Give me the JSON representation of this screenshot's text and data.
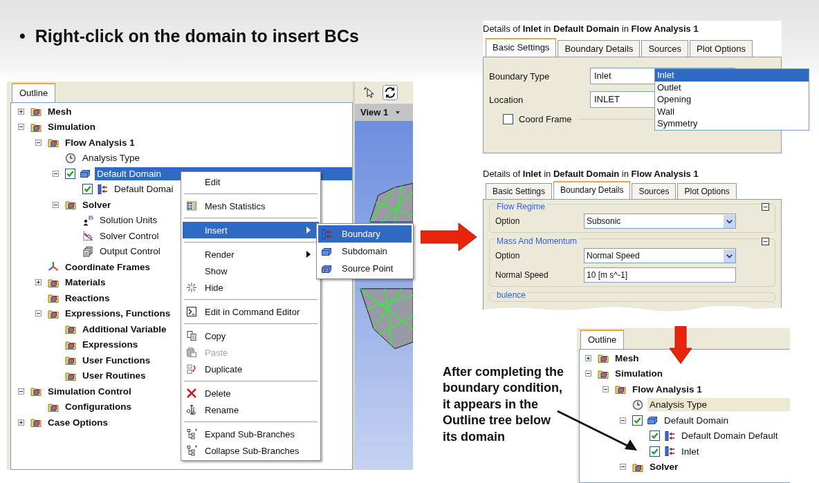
{
  "slide": {
    "bullet": "•",
    "title": "Right-click on the domain to insert BCs"
  },
  "outline": {
    "tab": "Outline",
    "focused": true,
    "tree": [
      {
        "label": "Mesh",
        "kind": "folder",
        "bold": true,
        "expanded": false,
        "selected": false
      },
      {
        "label": "Simulation",
        "kind": "folder",
        "bold": true,
        "expanded": true,
        "selected": false,
        "children": [
          {
            "label": "Flow Analysis 1",
            "kind": "folder",
            "bold": true,
            "expanded": true,
            "selected": false,
            "children": [
              {
                "label": "Analysis Type",
                "kind": "clock",
                "bold": false,
                "selected": false
              },
              {
                "label": "Default Domain",
                "kind": "box",
                "bold": false,
                "expanded": true,
                "checked": true,
                "selected": true,
                "children": [
                  {
                    "label": "Default Domai",
                    "kind": "boundary",
                    "bold": false,
                    "checked": true,
                    "selected": false
                  }
                ]
              },
              {
                "label": "Solver",
                "kind": "folder",
                "bold": true,
                "expanded": true,
                "selected": false,
                "children": [
                  {
                    "label": "Solution Units",
                    "kind": "person",
                    "bold": false,
                    "selected": false
                  },
                  {
                    "label": "Solver Control",
                    "kind": "chart",
                    "bold": false,
                    "selected": false
                  },
                  {
                    "label": "Output Control",
                    "kind": "pages",
                    "bold": false,
                    "selected": false
                  }
                ]
              }
            ]
          },
          {
            "label": "Coordinate Frames",
            "kind": "axes",
            "bold": true,
            "selected": false
          },
          {
            "label": "Materials",
            "kind": "folder",
            "bold": true,
            "expanded": false,
            "selected": false
          },
          {
            "label": "Reactions",
            "kind": "folder",
            "bold": true,
            "selected": false
          },
          {
            "label": "Expressions, Functions",
            "kind": "folder",
            "bold": true,
            "expanded": true,
            "selected": false,
            "children": [
              {
                "label": "Additional Variable",
                "kind": "folder",
                "bold": true,
                "selected": false
              },
              {
                "label": "Expressions",
                "kind": "folder",
                "bold": true,
                "selected": false
              },
              {
                "label": "User Functions",
                "kind": "folder",
                "bold": true,
                "selected": false
              },
              {
                "label": "User Routines",
                "kind": "folder",
                "bold": true,
                "selected": false
              }
            ]
          }
        ]
      },
      {
        "label": "Simulation Control",
        "kind": "folder",
        "bold": true,
        "expanded": true,
        "selected": false,
        "children": [
          {
            "label": "Configurations",
            "kind": "folder",
            "bold": true,
            "selected": false
          }
        ]
      },
      {
        "label": "Case Options",
        "kind": "folder",
        "bold": true,
        "expanded": false,
        "selected": false
      }
    ]
  },
  "viewport": {
    "tab": "View 1"
  },
  "context_menu": {
    "groups": [
      [
        {
          "label": "Edit",
          "selected": false,
          "disabled": false,
          "submenu": false
        }
      ],
      [
        {
          "label": "Mesh Statistics",
          "kind": "grid",
          "selected": false,
          "disabled": false,
          "submenu": false
        }
      ],
      [
        {
          "label": "Insert",
          "selected": true,
          "disabled": false,
          "submenu": true
        }
      ],
      [
        {
          "label": "Render",
          "selected": false,
          "disabled": false,
          "submenu": true
        },
        {
          "label": "Show",
          "selected": false,
          "disabled": false,
          "submenu": false
        },
        {
          "label": "Hide",
          "kind": "sparkle",
          "selected": false,
          "disabled": false,
          "submenu": false
        }
      ],
      [
        {
          "label": "Edit in Command Editor",
          "kind": "terminal",
          "selected": false,
          "disabled": false,
          "submenu": false
        }
      ],
      [
        {
          "label": "Copy",
          "kind": "copy",
          "selected": false,
          "disabled": false,
          "submenu": false
        },
        {
          "label": "Paste",
          "kind": "clipboard",
          "selected": false,
          "disabled": true,
          "submenu": false
        },
        {
          "label": "Duplicate",
          "kind": "duplicate",
          "selected": false,
          "disabled": false,
          "submenu": false
        }
      ],
      [
        {
          "label": "Delete",
          "kind": "delete",
          "selected": false,
          "disabled": false,
          "submenu": false
        },
        {
          "label": "Rename",
          "kind": "rename",
          "selected": false,
          "disabled": false,
          "submenu": false
        }
      ],
      [
        {
          "label": "Expand Sub-Branches",
          "kind": "tree",
          "selected": false,
          "disabled": false,
          "submenu": false
        },
        {
          "label": "Collapse Sub-Branches",
          "kind": "tree",
          "selected": false,
          "disabled": false,
          "submenu": false
        }
      ]
    ]
  },
  "submenu": {
    "items": [
      {
        "label": "Boundary",
        "kind": "boundary",
        "selected": true
      },
      {
        "label": "Subdomain",
        "kind": "box",
        "selected": false
      },
      {
        "label": "Source Point",
        "kind": "boxdot",
        "selected": false
      }
    ]
  },
  "basic_settings_panel": {
    "heading": "Details of **Inlet** in **Default Domain** in **Flow Analysis 1**",
    "tabs": [
      {
        "label": "Basic Settings",
        "selected": true
      },
      {
        "label": "Boundary Details",
        "selected": false
      },
      {
        "label": "Sources",
        "selected": false
      },
      {
        "label": "Plot Options",
        "selected": false
      }
    ],
    "fields": [
      {
        "label": "Boundary Type",
        "value": "Inlet"
      },
      {
        "label": "Location",
        "value": "INLET"
      }
    ],
    "coord_frame": {
      "label": "Coord Frame",
      "checked": false
    },
    "dropdown": {
      "options": [
        {
          "label": "Inlet",
          "selected": true
        },
        {
          "label": "Outlet",
          "selected": false
        },
        {
          "label": "Opening",
          "selected": false
        },
        {
          "label": "Wall",
          "selected": false
        },
        {
          "label": "Symmetry",
          "selected": false
        }
      ]
    }
  },
  "boundary_details_panel": {
    "heading": "Details of **Inlet** in **Default Domain** in **Flow Analysis 1**",
    "tabs": [
      {
        "label": "Basic Settings",
        "selected": false
      },
      {
        "label": "Boundary Details",
        "selected": true
      },
      {
        "label": "Sources",
        "selected": false
      },
      {
        "label": "Plot Options",
        "selected": false
      }
    ],
    "sections": [
      {
        "title": "Flow Regime",
        "expanded": true,
        "rows": [
          {
            "label": "Option",
            "kind": "select",
            "value": "Subsonic"
          }
        ]
      },
      {
        "title": "Mass And Momentum",
        "expanded": true,
        "rows": [
          {
            "label": "Option",
            "kind": "select",
            "value": "Normal Speed"
          },
          {
            "label": "Normal Speed",
            "kind": "text",
            "value": "10 [m s^-1]"
          }
        ]
      },
      {
        "title": "bulence"
      }
    ]
  },
  "note": "After completing the boundary condition, it appears in the Outline tree below its domain",
  "result_outline": {
    "tab": "Outline",
    "focused": false,
    "tree": [
      {
        "label": "Mesh",
        "kind": "folder",
        "bold": true,
        "expanded": false,
        "selected": false
      },
      {
        "label": "Simulation",
        "kind": "folder",
        "bold": true,
        "expanded": true,
        "selected": false,
        "children": [
          {
            "label": "Flow Analysis 1",
            "kind": "folder",
            "bold": true,
            "expanded": true,
            "selected": false,
            "children": [
              {
                "label": "Analysis Type",
                "kind": "clock",
                "bold": false,
                "selected": true
              },
              {
                "label": "Default Domain",
                "kind": "box",
                "bold": false,
                "expanded": true,
                "checked": true,
                "selected": false,
                "children": [
                  {
                    "label": "Default Domain Default",
                    "kind": "boundary",
                    "bold": false,
                    "checked": true,
                    "selected": false
                  },
                  {
                    "label": "Inlet",
                    "kind": "boundary",
                    "bold": false,
                    "checked": true,
                    "selected": false
                  }
                ]
              },
              {
                "label": "Solver",
                "kind": "folder",
                "bold": true,
                "expanded": true,
                "selected": false
              }
            ]
          }
        ]
      }
    ]
  }
}
